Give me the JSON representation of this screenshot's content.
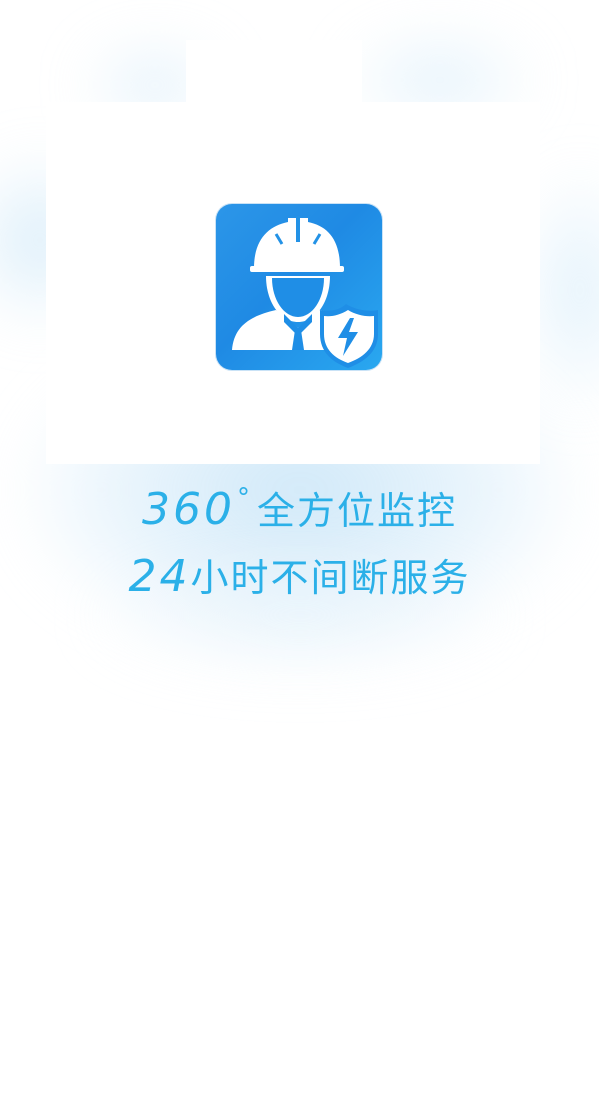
{
  "screen": {
    "name": "splash-screen",
    "accent_color": "#2bb0e8",
    "icon_color": "#2596e6"
  },
  "app_icon": {
    "icon_name": "engineer-hardhat-shield-icon"
  },
  "slogan": {
    "line1_number": "360",
    "line1_degree": "°",
    "line1_text": "全方位监控",
    "line2_number": "24",
    "line2_text": "小时不间断服务"
  }
}
